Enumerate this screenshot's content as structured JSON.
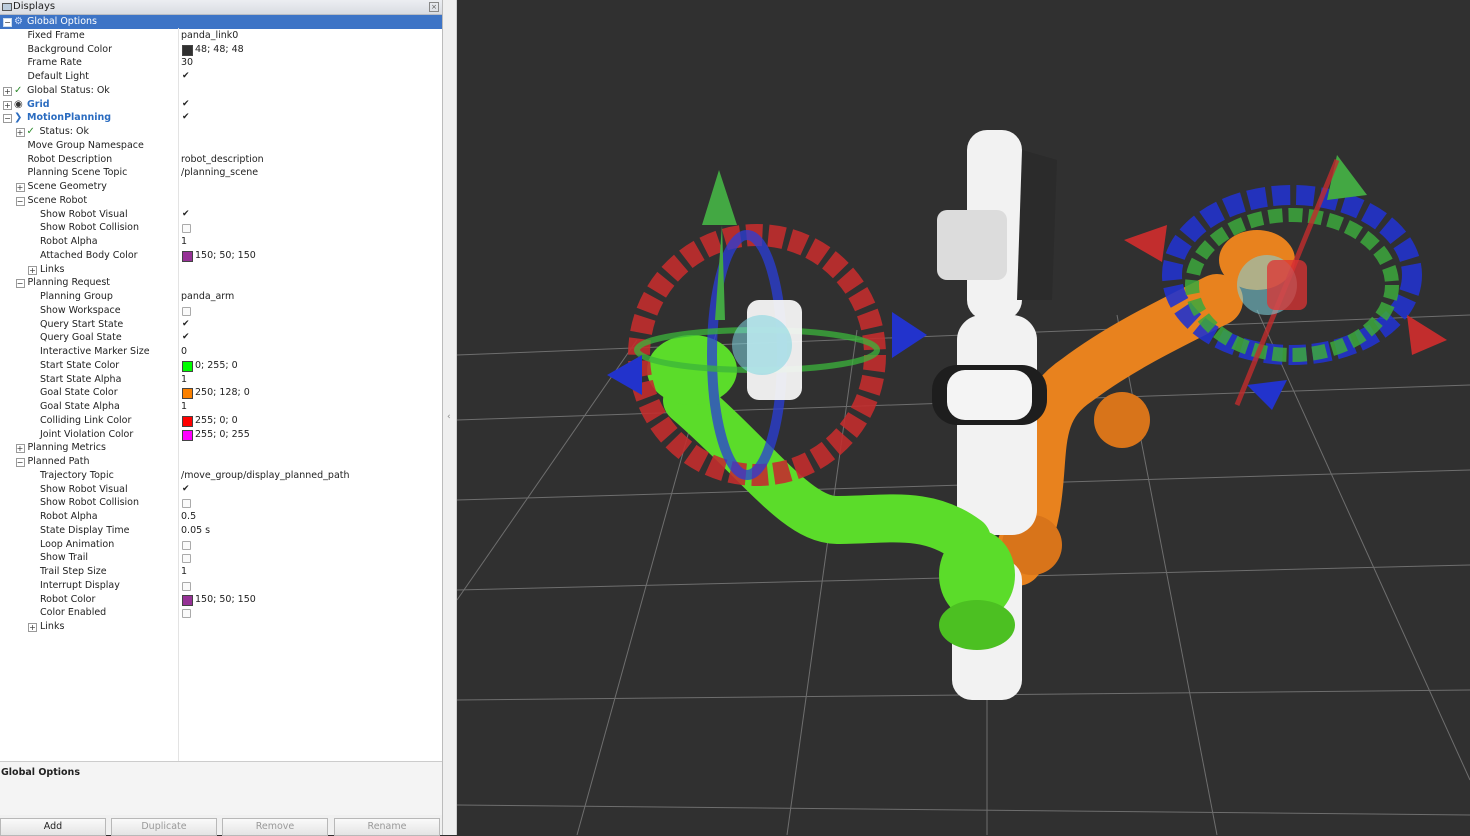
{
  "panel": {
    "title": "Displays",
    "rows": [
      {
        "indent": 0,
        "exp": "-",
        "icon": "gear-icon",
        "glyph": "⚙",
        "label": "Global Options",
        "bold": false,
        "selected": true
      },
      {
        "indent": 1,
        "label": "Fixed Frame",
        "value": "panda_link0"
      },
      {
        "indent": 1,
        "label": "Background Color",
        "swatch": "#303030",
        "value": "48; 48; 48"
      },
      {
        "indent": 1,
        "label": "Frame Rate",
        "value": "30"
      },
      {
        "indent": 1,
        "label": "Default Light",
        "check": true
      },
      {
        "indent": 0,
        "exp": "+",
        "icon": "check-icon",
        "glyph": "✓",
        "label": "Global Status: Ok"
      },
      {
        "indent": 0,
        "exp": "+",
        "icon": "grid-icon",
        "glyph": "◉",
        "label": "Grid",
        "blue": true,
        "check": true
      },
      {
        "indent": 0,
        "exp": "-",
        "icon": "motion-planning-icon",
        "glyph": "❯",
        "label": "MotionPlanning",
        "blue": true,
        "check": true
      },
      {
        "indent": 1,
        "exp": "+",
        "icon": "check-icon",
        "glyph": "✓",
        "label": "Status: Ok"
      },
      {
        "indent": 1,
        "label": "Move Group Namespace",
        "value": ""
      },
      {
        "indent": 1,
        "label": "Robot Description",
        "value": "robot_description"
      },
      {
        "indent": 1,
        "label": "Planning Scene Topic",
        "value": "/planning_scene"
      },
      {
        "indent": 1,
        "exp": "+",
        "label": "Scene Geometry"
      },
      {
        "indent": 1,
        "exp": "-",
        "label": "Scene Robot"
      },
      {
        "indent": 2,
        "label": "Show Robot Visual",
        "check": true
      },
      {
        "indent": 2,
        "label": "Show Robot Collision",
        "check": false
      },
      {
        "indent": 2,
        "label": "Robot Alpha",
        "value": "1"
      },
      {
        "indent": 2,
        "label": "Attached Body Color",
        "swatch": "#963296",
        "value": "150; 50; 150"
      },
      {
        "indent": 2,
        "exp": "+",
        "label": "Links"
      },
      {
        "indent": 1,
        "exp": "-",
        "label": "Planning Request"
      },
      {
        "indent": 2,
        "label": "Planning Group",
        "value": "panda_arm"
      },
      {
        "indent": 2,
        "label": "Show Workspace",
        "check": false
      },
      {
        "indent": 2,
        "label": "Query Start State",
        "check": true
      },
      {
        "indent": 2,
        "label": "Query Goal State",
        "check": true
      },
      {
        "indent": 2,
        "label": "Interactive Marker Size",
        "value": "0"
      },
      {
        "indent": 2,
        "label": "Start State Color",
        "swatch": "#00ff00",
        "value": "0; 255; 0"
      },
      {
        "indent": 2,
        "label": "Start State Alpha",
        "value": "1"
      },
      {
        "indent": 2,
        "label": "Goal State Color",
        "swatch": "#fa8000",
        "value": "250; 128; 0"
      },
      {
        "indent": 2,
        "label": "Goal State Alpha",
        "value": "1"
      },
      {
        "indent": 2,
        "label": "Colliding Link Color",
        "swatch": "#ff0000",
        "value": "255; 0; 0"
      },
      {
        "indent": 2,
        "label": "Joint Violation Color",
        "swatch": "#ff00ff",
        "value": "255; 0; 255"
      },
      {
        "indent": 1,
        "exp": "+",
        "label": "Planning Metrics"
      },
      {
        "indent": 1,
        "exp": "-",
        "label": "Planned Path"
      },
      {
        "indent": 2,
        "label": "Trajectory Topic",
        "value": "/move_group/display_planned_path"
      },
      {
        "indent": 2,
        "label": "Show Robot Visual",
        "check": true
      },
      {
        "indent": 2,
        "label": "Show Robot Collision",
        "check": false
      },
      {
        "indent": 2,
        "label": "Robot Alpha",
        "value": "0.5"
      },
      {
        "indent": 2,
        "label": "State Display Time",
        "value": "0.05 s"
      },
      {
        "indent": 2,
        "label": "Loop Animation",
        "check": false
      },
      {
        "indent": 2,
        "label": "Show Trail",
        "check": false
      },
      {
        "indent": 2,
        "label": "Trail Step Size",
        "value": "1"
      },
      {
        "indent": 2,
        "label": "Interrupt Display",
        "check": false
      },
      {
        "indent": 2,
        "label": "Robot Color",
        "swatch": "#963296",
        "value": "150; 50; 150"
      },
      {
        "indent": 2,
        "label": "Color Enabled",
        "check": false
      },
      {
        "indent": 2,
        "exp": "+",
        "label": "Links"
      }
    ],
    "description_title": "Global Options",
    "buttons": [
      {
        "label": "Add",
        "enabled": true
      },
      {
        "label": "Duplicate",
        "enabled": false
      },
      {
        "label": "Remove",
        "enabled": false
      },
      {
        "label": "Rename",
        "enabled": false
      }
    ]
  },
  "viewport": {
    "background": "#303030",
    "start_state_color": "#5bdc2a",
    "goal_state_color": "#e8821e",
    "robot_color": "#f2f2f2"
  }
}
